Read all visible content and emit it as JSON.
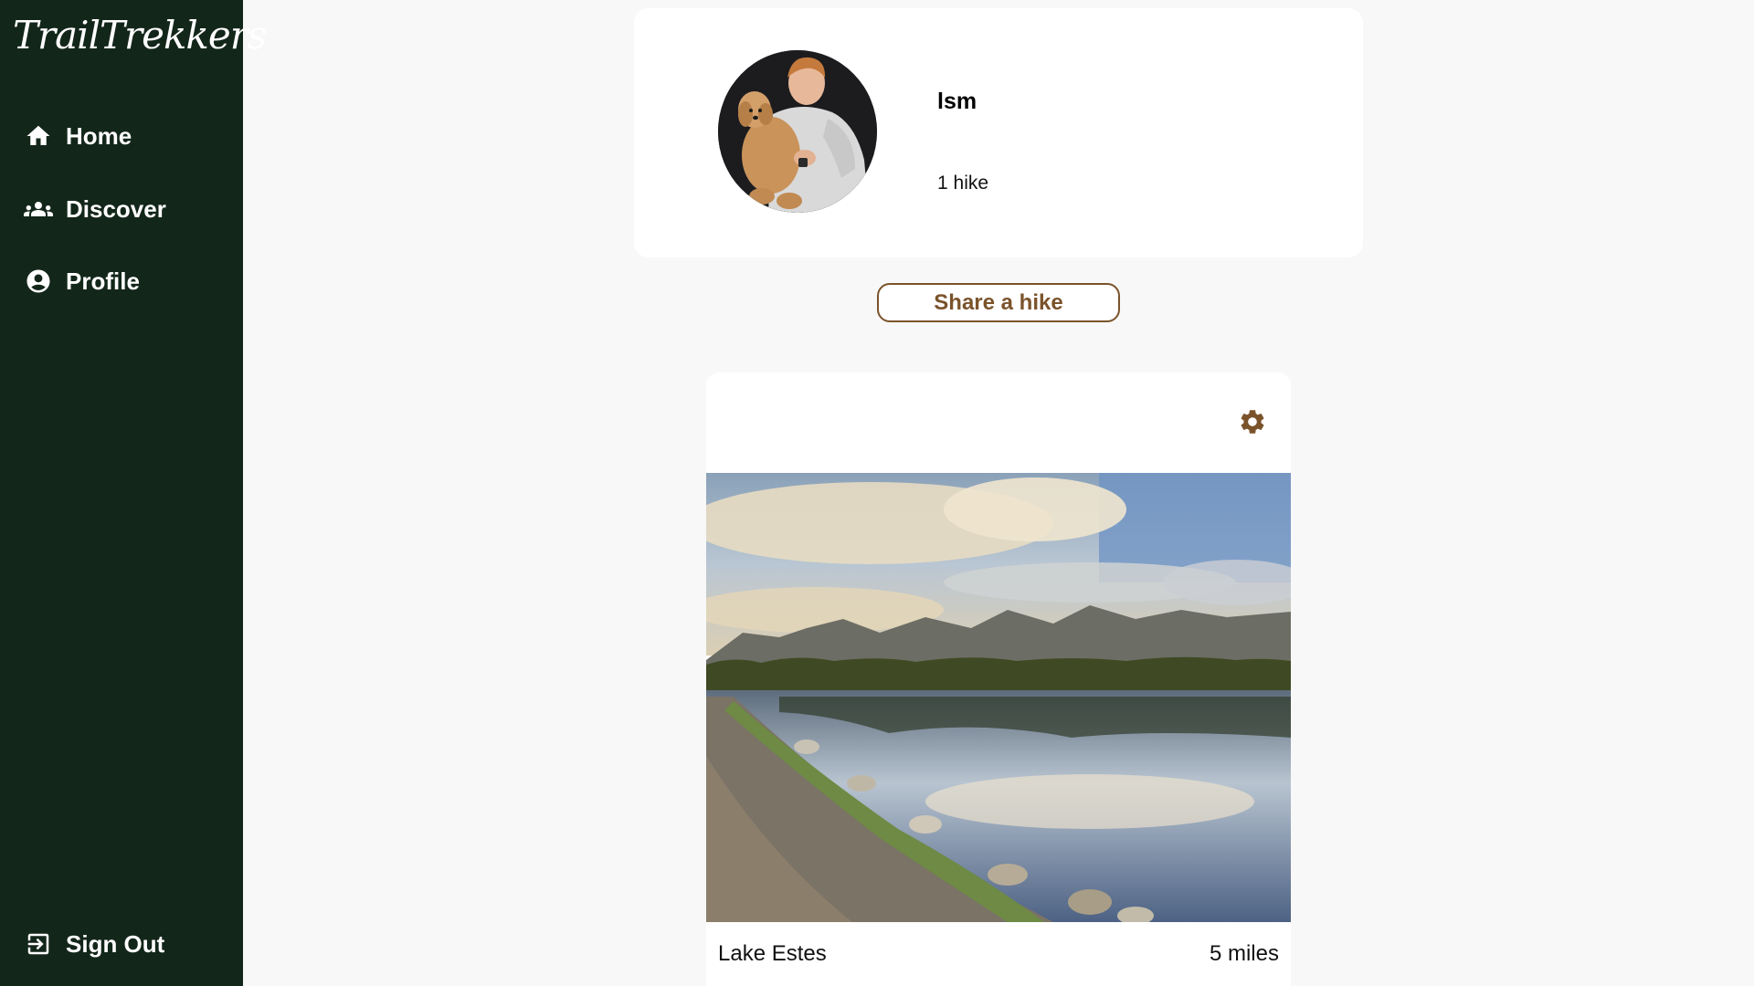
{
  "app": {
    "logo_text": "TrailTrekkers"
  },
  "sidebar": {
    "items": [
      {
        "label": "Home",
        "icon": "home-icon"
      },
      {
        "label": "Discover",
        "icon": "people-icon"
      },
      {
        "label": "Profile",
        "icon": "account-circle-icon"
      }
    ],
    "signout": {
      "label": "Sign Out",
      "icon": "logout-icon"
    }
  },
  "profile": {
    "username": "lsm",
    "hike_count": "1 hike"
  },
  "actions": {
    "share_label": "Share a hike"
  },
  "hikes": [
    {
      "name": "Lake Estes",
      "distance": "5 miles",
      "settings_icon": "gear-icon"
    }
  ],
  "colors": {
    "sidebar_bg": "#13261a",
    "accent_brown": "#7b532b",
    "page_bg": "#f8f8f8"
  }
}
